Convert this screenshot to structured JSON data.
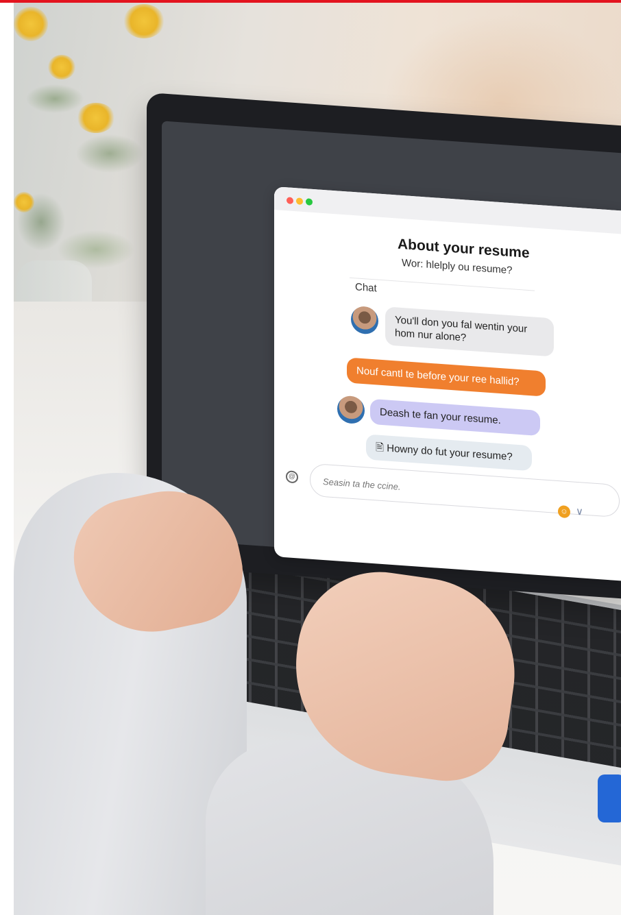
{
  "chat": {
    "title": "About your resume",
    "subtitle": "Wor: hlelply ou resume?",
    "section_label": "Chat",
    "messages": [
      {
        "text": "You'll don you fal wentin your hom nur alone?",
        "style": "gray",
        "avatar": true
      },
      {
        "text": "Nouf cantl te before your ree hallid?",
        "style": "orange",
        "avatar": false
      },
      {
        "text": "Deash te fan your resume.",
        "style": "purple",
        "avatar": true
      },
      {
        "text": "Howny do fut your resume?",
        "style": "light",
        "avatar": false,
        "icon": "document-icon"
      }
    ],
    "input_placeholder": "Seasin ta the ccine.",
    "colors": {
      "user_bubble": "#f07f2e",
      "assistant_bubble": "#ccc9f4",
      "gray_bubble": "#e9e9eb",
      "emoji_button": "#f0a020"
    }
  },
  "window_controls": [
    "close",
    "minimize",
    "maximize"
  ],
  "icons": {
    "attach": "attach-icon",
    "emoji": "emoji-icon",
    "send": "send-chevron-icon"
  }
}
